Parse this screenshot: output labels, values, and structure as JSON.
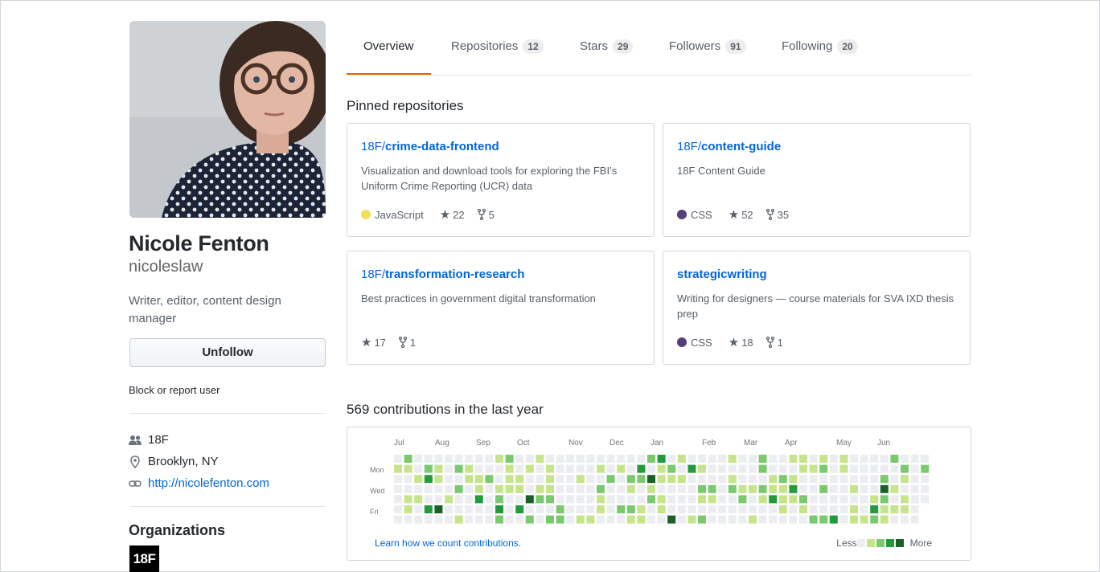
{
  "profile": {
    "name": "Nicole Fenton",
    "username": "nicoleslaw",
    "bio": "Writer, editor, content design manager",
    "follow_button": "Unfollow",
    "block_link": "Block or report user",
    "company": "18F",
    "location": "Brooklyn, NY",
    "website": "http://nicolefenton.com",
    "organizations_title": "Organizations",
    "org_logo_text": "18F"
  },
  "tabs": [
    {
      "label": "Overview",
      "count": null,
      "selected": true
    },
    {
      "label": "Repositories",
      "count": "12"
    },
    {
      "label": "Stars",
      "count": "29"
    },
    {
      "label": "Followers",
      "count": "91"
    },
    {
      "label": "Following",
      "count": "20"
    }
  ],
  "pinned": {
    "title": "Pinned repositories",
    "repos": [
      {
        "owner": "18F/",
        "name": "crime-data-frontend",
        "description": "Visualization and download tools for exploring the FBI’s Uniform Crime Reporting (UCR) data",
        "language": "JavaScript",
        "language_color": "#f1e05a",
        "stars": "22",
        "forks": "5"
      },
      {
        "owner": "18F/",
        "name": "content-guide",
        "description": "18F Content Guide",
        "language": "CSS",
        "language_color": "#563d7c",
        "stars": "52",
        "forks": "35"
      },
      {
        "owner": "18F/",
        "name": "transformation-research",
        "description": "Best practices in government digital transformation",
        "language": "",
        "language_color": "",
        "stars": "17",
        "forks": "1"
      },
      {
        "owner": "",
        "name": "strategicwriting",
        "description": "Writing for designers — course materials for SVA IXD thesis prep",
        "language": "CSS",
        "language_color": "#563d7c",
        "stars": "18",
        "forks": "1"
      }
    ]
  },
  "contributions": {
    "title": "569 contributions in the last year",
    "months": [
      "Jul",
      "Aug",
      "Sep",
      "Oct",
      "Nov",
      "Dec",
      "Jan",
      "Feb",
      "Mar",
      "Apr",
      "May",
      "Jun"
    ],
    "days": [
      "Mon",
      "Wed",
      "Fri"
    ],
    "learn_link": "Learn how we count contributions.",
    "legend_less": "Less",
    "legend_more": "More",
    "colors": [
      "#ebedf0",
      "#c6e48b",
      "#7bc96f",
      "#239a3b",
      "#196127"
    ]
  }
}
